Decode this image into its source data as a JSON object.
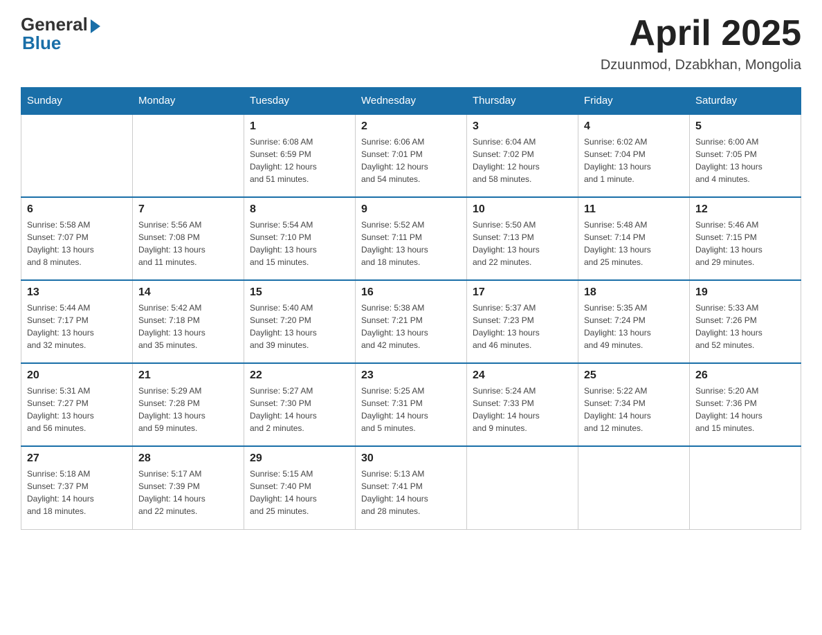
{
  "header": {
    "logo_general": "General",
    "logo_blue": "Blue",
    "month_title": "April 2025",
    "location": "Dzuunmod, Dzabkhan, Mongolia"
  },
  "days_of_week": [
    "Sunday",
    "Monday",
    "Tuesday",
    "Wednesday",
    "Thursday",
    "Friday",
    "Saturday"
  ],
  "weeks": [
    [
      {
        "day": "",
        "info": ""
      },
      {
        "day": "",
        "info": ""
      },
      {
        "day": "1",
        "info": "Sunrise: 6:08 AM\nSunset: 6:59 PM\nDaylight: 12 hours\nand 51 minutes."
      },
      {
        "day": "2",
        "info": "Sunrise: 6:06 AM\nSunset: 7:01 PM\nDaylight: 12 hours\nand 54 minutes."
      },
      {
        "day": "3",
        "info": "Sunrise: 6:04 AM\nSunset: 7:02 PM\nDaylight: 12 hours\nand 58 minutes."
      },
      {
        "day": "4",
        "info": "Sunrise: 6:02 AM\nSunset: 7:04 PM\nDaylight: 13 hours\nand 1 minute."
      },
      {
        "day": "5",
        "info": "Sunrise: 6:00 AM\nSunset: 7:05 PM\nDaylight: 13 hours\nand 4 minutes."
      }
    ],
    [
      {
        "day": "6",
        "info": "Sunrise: 5:58 AM\nSunset: 7:07 PM\nDaylight: 13 hours\nand 8 minutes."
      },
      {
        "day": "7",
        "info": "Sunrise: 5:56 AM\nSunset: 7:08 PM\nDaylight: 13 hours\nand 11 minutes."
      },
      {
        "day": "8",
        "info": "Sunrise: 5:54 AM\nSunset: 7:10 PM\nDaylight: 13 hours\nand 15 minutes."
      },
      {
        "day": "9",
        "info": "Sunrise: 5:52 AM\nSunset: 7:11 PM\nDaylight: 13 hours\nand 18 minutes."
      },
      {
        "day": "10",
        "info": "Sunrise: 5:50 AM\nSunset: 7:13 PM\nDaylight: 13 hours\nand 22 minutes."
      },
      {
        "day": "11",
        "info": "Sunrise: 5:48 AM\nSunset: 7:14 PM\nDaylight: 13 hours\nand 25 minutes."
      },
      {
        "day": "12",
        "info": "Sunrise: 5:46 AM\nSunset: 7:15 PM\nDaylight: 13 hours\nand 29 minutes."
      }
    ],
    [
      {
        "day": "13",
        "info": "Sunrise: 5:44 AM\nSunset: 7:17 PM\nDaylight: 13 hours\nand 32 minutes."
      },
      {
        "day": "14",
        "info": "Sunrise: 5:42 AM\nSunset: 7:18 PM\nDaylight: 13 hours\nand 35 minutes."
      },
      {
        "day": "15",
        "info": "Sunrise: 5:40 AM\nSunset: 7:20 PM\nDaylight: 13 hours\nand 39 minutes."
      },
      {
        "day": "16",
        "info": "Sunrise: 5:38 AM\nSunset: 7:21 PM\nDaylight: 13 hours\nand 42 minutes."
      },
      {
        "day": "17",
        "info": "Sunrise: 5:37 AM\nSunset: 7:23 PM\nDaylight: 13 hours\nand 46 minutes."
      },
      {
        "day": "18",
        "info": "Sunrise: 5:35 AM\nSunset: 7:24 PM\nDaylight: 13 hours\nand 49 minutes."
      },
      {
        "day": "19",
        "info": "Sunrise: 5:33 AM\nSunset: 7:26 PM\nDaylight: 13 hours\nand 52 minutes."
      }
    ],
    [
      {
        "day": "20",
        "info": "Sunrise: 5:31 AM\nSunset: 7:27 PM\nDaylight: 13 hours\nand 56 minutes."
      },
      {
        "day": "21",
        "info": "Sunrise: 5:29 AM\nSunset: 7:28 PM\nDaylight: 13 hours\nand 59 minutes."
      },
      {
        "day": "22",
        "info": "Sunrise: 5:27 AM\nSunset: 7:30 PM\nDaylight: 14 hours\nand 2 minutes."
      },
      {
        "day": "23",
        "info": "Sunrise: 5:25 AM\nSunset: 7:31 PM\nDaylight: 14 hours\nand 5 minutes."
      },
      {
        "day": "24",
        "info": "Sunrise: 5:24 AM\nSunset: 7:33 PM\nDaylight: 14 hours\nand 9 minutes."
      },
      {
        "day": "25",
        "info": "Sunrise: 5:22 AM\nSunset: 7:34 PM\nDaylight: 14 hours\nand 12 minutes."
      },
      {
        "day": "26",
        "info": "Sunrise: 5:20 AM\nSunset: 7:36 PM\nDaylight: 14 hours\nand 15 minutes."
      }
    ],
    [
      {
        "day": "27",
        "info": "Sunrise: 5:18 AM\nSunset: 7:37 PM\nDaylight: 14 hours\nand 18 minutes."
      },
      {
        "day": "28",
        "info": "Sunrise: 5:17 AM\nSunset: 7:39 PM\nDaylight: 14 hours\nand 22 minutes."
      },
      {
        "day": "29",
        "info": "Sunrise: 5:15 AM\nSunset: 7:40 PM\nDaylight: 14 hours\nand 25 minutes."
      },
      {
        "day": "30",
        "info": "Sunrise: 5:13 AM\nSunset: 7:41 PM\nDaylight: 14 hours\nand 28 minutes."
      },
      {
        "day": "",
        "info": ""
      },
      {
        "day": "",
        "info": ""
      },
      {
        "day": "",
        "info": ""
      }
    ]
  ]
}
